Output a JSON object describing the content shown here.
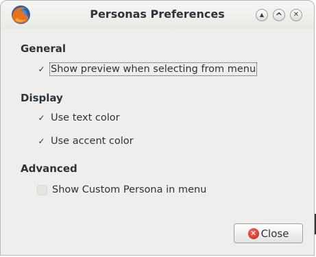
{
  "window": {
    "title": "Personas Preferences",
    "app_icon": "firefox-icon",
    "controls": [
      {
        "name": "minimize-button",
        "icon": "arrow-up-icon",
        "glyph": "▲"
      },
      {
        "name": "maximize-button",
        "icon": "chevron-up-icon",
        "glyph": "^"
      },
      {
        "name": "close-window-button",
        "icon": "close-icon",
        "glyph": "✕"
      }
    ]
  },
  "sections": {
    "general": {
      "title": "General",
      "options": [
        {
          "label": "Show preview when selecting from menu",
          "checked": true,
          "focused": true
        }
      ]
    },
    "display": {
      "title": "Display",
      "options": [
        {
          "label": "Use text color",
          "checked": true
        },
        {
          "label": "Use accent color",
          "checked": true
        }
      ]
    },
    "advanced": {
      "title": "Advanced",
      "options": [
        {
          "label": "Show Custom Persona in menu",
          "checked": false
        }
      ]
    }
  },
  "buttons": {
    "close_label": "Close",
    "close_icon": "close-circle-icon",
    "check_glyph": "✓"
  },
  "colors": {
    "window_bg": "#eeeeec",
    "text": "#2e3436",
    "close_icon_red": "#d22d24"
  }
}
